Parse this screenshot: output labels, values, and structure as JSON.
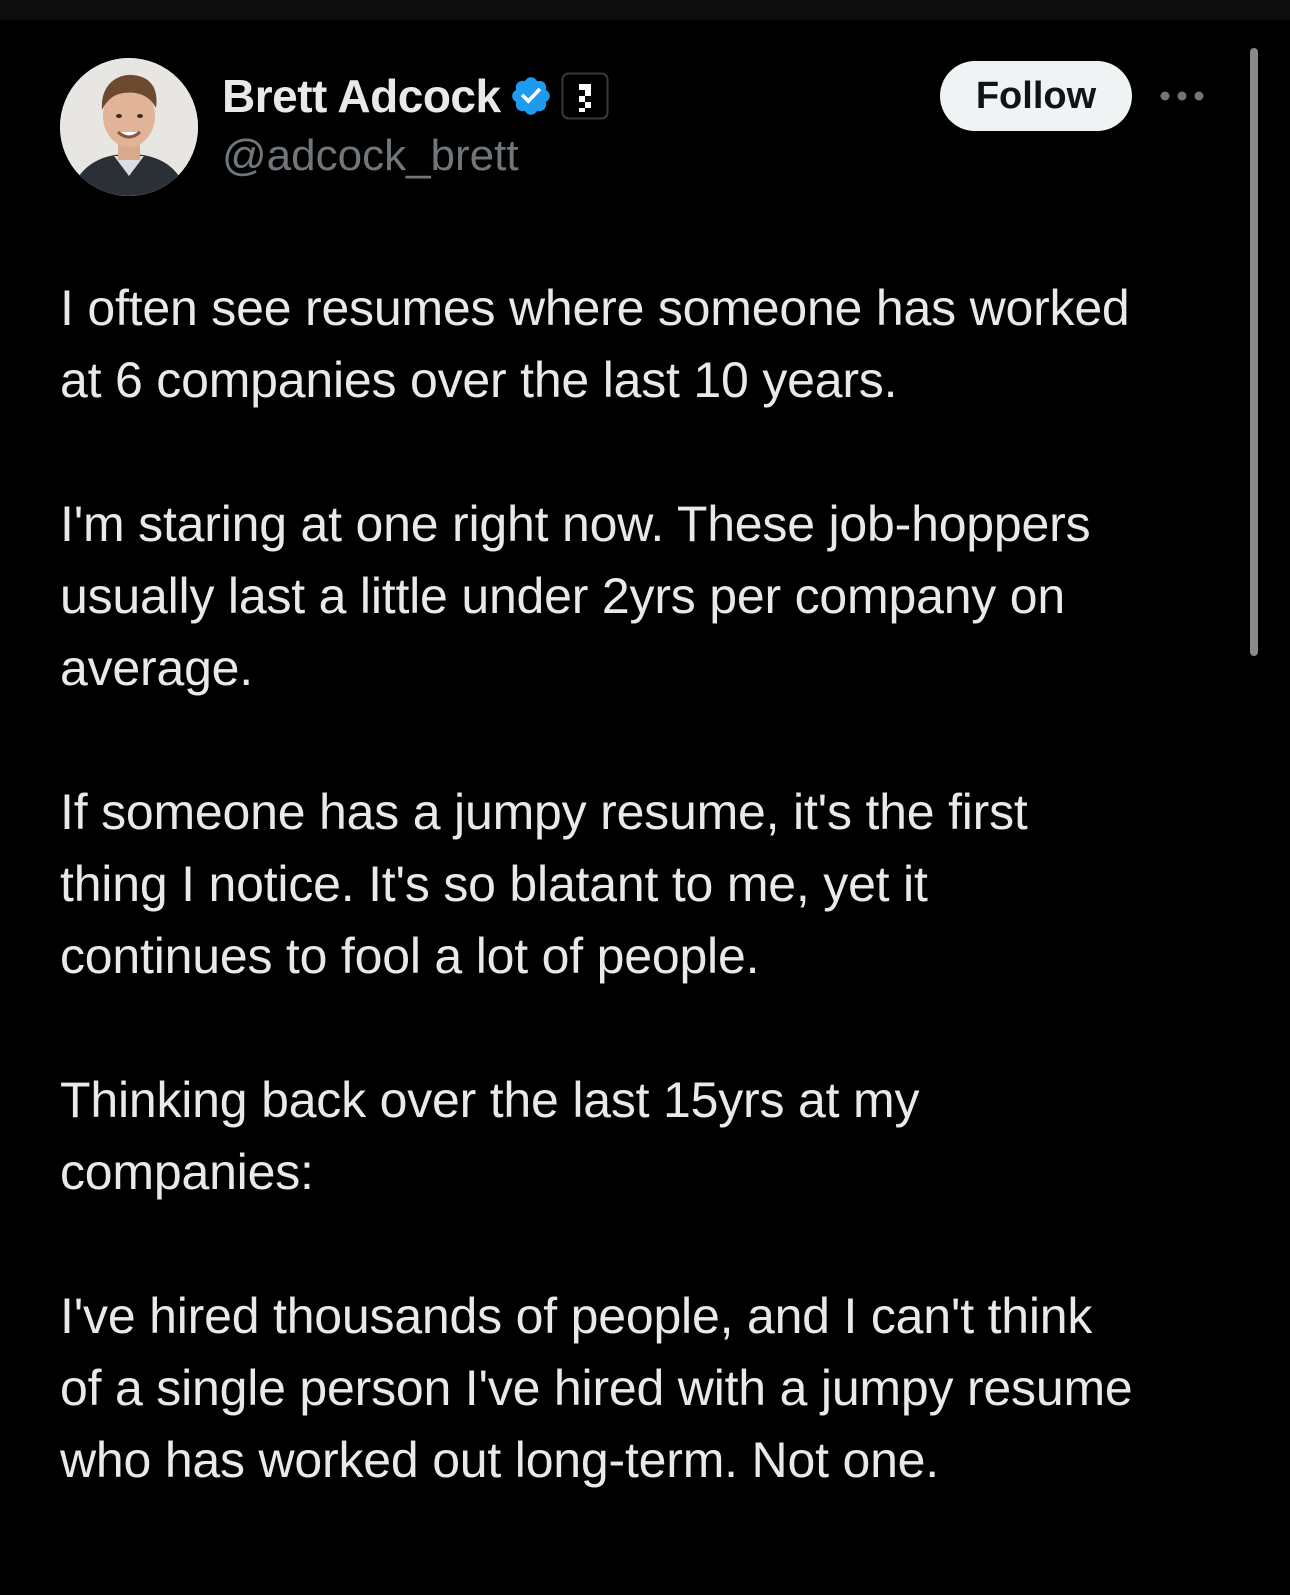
{
  "author": {
    "display_name": "Brett Adcock",
    "handle": "@adcock_brett",
    "avatar_icon": "profile-photo",
    "verified_icon": "verified-badge-icon",
    "affiliate_icon": "affiliate-badge-icon"
  },
  "actions": {
    "follow_label": "Follow",
    "more_icon": "more-options-icon"
  },
  "post": {
    "paragraphs": [
      "I often see resumes where someone has worked\nat 6 companies over the last 10 years.",
      "I'm staring at one right now. These job-hoppers\nusually last a little under 2yrs per company on\naverage.",
      "If someone has a jumpy resume, it's the first\nthing I notice. It's so blatant to me, yet it\ncontinues to fool a lot of people.",
      "Thinking back over the last 15yrs at my\ncompanies:",
      "I've hired thousands of people, and I can't think\nof a single person I've hired with a jumpy resume\nwho has worked out long-term. Not one."
    ]
  },
  "colors": {
    "background": "#000000",
    "text_primary": "#e7e9ea",
    "text_secondary": "#71767b",
    "verified_blue": "#1d9bf0",
    "follow_bg": "#eff3f4",
    "follow_text": "#0f1419"
  }
}
